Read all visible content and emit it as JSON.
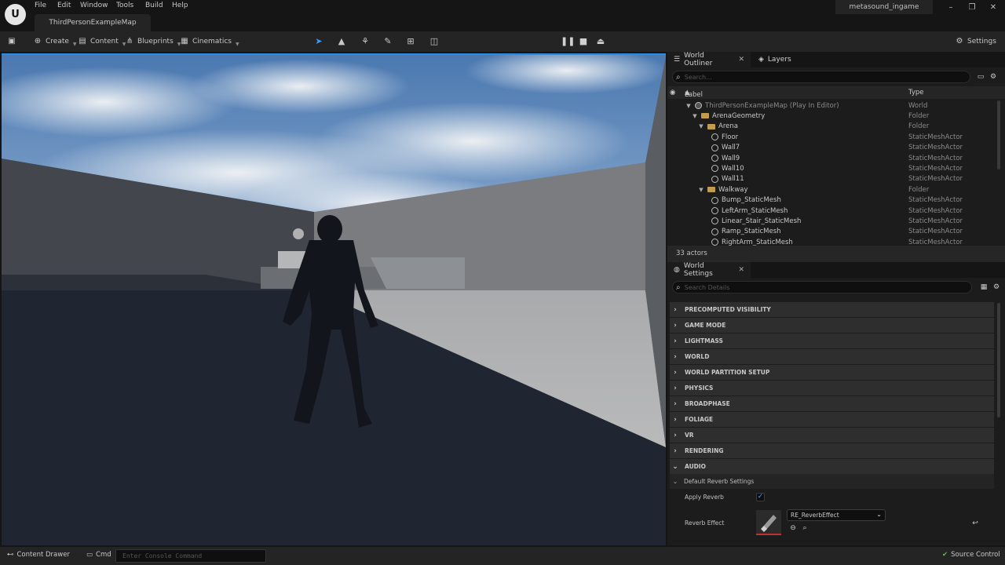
{
  "menu": {
    "file": "File",
    "edit": "Edit",
    "window": "Window",
    "tools": "Tools",
    "build": "Build",
    "help": "Help"
  },
  "level_tab": "ThirdPersonExampleMap",
  "project_name": "metasound_ingame",
  "toolbar": {
    "create": "Create",
    "content": "Content",
    "blueprints": "Blueprints",
    "cinematics": "Cinematics",
    "settings": "Settings"
  },
  "outliner": {
    "tab": "World Outliner",
    "layers_tab": "Layers",
    "search_placeholder": "Search...",
    "col_label": "Label",
    "col_type": "Type",
    "rows": [
      {
        "label": "ThirdPersonExampleMap (Play In Editor)",
        "type": "World"
      },
      {
        "label": "ArenaGeometry",
        "type": "Folder"
      },
      {
        "label": "Arena",
        "type": "Folder"
      },
      {
        "label": "Floor",
        "type": "StaticMeshActor"
      },
      {
        "label": "Wall7",
        "type": "StaticMeshActor"
      },
      {
        "label": "Wall9",
        "type": "StaticMeshActor"
      },
      {
        "label": "Wall10",
        "type": "StaticMeshActor"
      },
      {
        "label": "Wall11",
        "type": "StaticMeshActor"
      },
      {
        "label": "Walkway",
        "type": "Folder"
      },
      {
        "label": "Bump_StaticMesh",
        "type": "StaticMeshActor"
      },
      {
        "label": "LeftArm_StaticMesh",
        "type": "StaticMeshActor"
      },
      {
        "label": "Linear_Stair_StaticMesh",
        "type": "StaticMeshActor"
      },
      {
        "label": "Ramp_StaticMesh",
        "type": "StaticMeshActor"
      },
      {
        "label": "RightArm_StaticMesh",
        "type": "StaticMeshActor"
      }
    ],
    "actor_count": "33 actors"
  },
  "world_settings": {
    "tab": "World Settings",
    "search_placeholder": "Search Details",
    "categories": [
      "PRECOMPUTED VISIBILITY",
      "GAME MODE",
      "LIGHTMASS",
      "WORLD",
      "WORLD PARTITION SETUP",
      "PHYSICS",
      "BROADPHASE",
      "FOLIAGE",
      "VR",
      "RENDERING",
      "AUDIO"
    ],
    "subcategory": "Default Reverb Settings",
    "apply_reverb_label": "Apply Reverb",
    "reverb_effect_label": "Reverb Effect",
    "reverb_effect_value": "RE_ReverbEffect"
  },
  "statusbar": {
    "content_drawer": "Content Drawer",
    "cmd": "Cmd",
    "console_placeholder": "Enter Console Command",
    "source_control": "Source Control"
  },
  "colors": {
    "accent_blue": "#2a8be0",
    "folder": "#c49b4a",
    "source_control_ok": "#5fbf4a"
  }
}
